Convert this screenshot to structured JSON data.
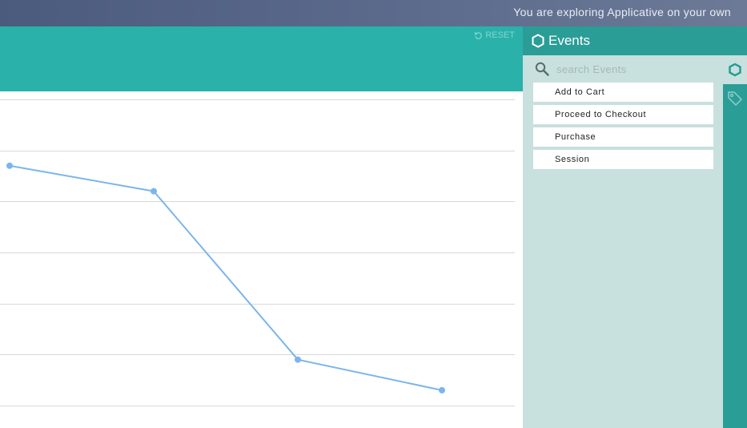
{
  "topbar": {
    "message": "You are exploring Applicative on your own"
  },
  "chart_header": {
    "reset_label": "RESET"
  },
  "events_panel": {
    "title": "Events",
    "search_placeholder": "search Events",
    "items": [
      {
        "label": "Add to Cart"
      },
      {
        "label": "Proceed to Checkout"
      },
      {
        "label": "Purchase"
      },
      {
        "label": "Session"
      }
    ]
  },
  "icons": {
    "reset": "reset-icon",
    "events": "hexagon-icon",
    "search": "search-icon",
    "tags": "tag-icon"
  },
  "colors": {
    "topbar": "#4b5b7e",
    "chart_header": "#2ab1aa",
    "panel_header": "#2a9d96",
    "panel_bg": "#c8e0de",
    "series": "#7cb5ec",
    "gridline": "#d8d8d8"
  },
  "chart_data": {
    "type": "line",
    "grid": true,
    "ylim": [
      0,
      6
    ],
    "series": [
      {
        "values": [
          4.7,
          4.2,
          0.9,
          0.3
        ]
      }
    ]
  }
}
